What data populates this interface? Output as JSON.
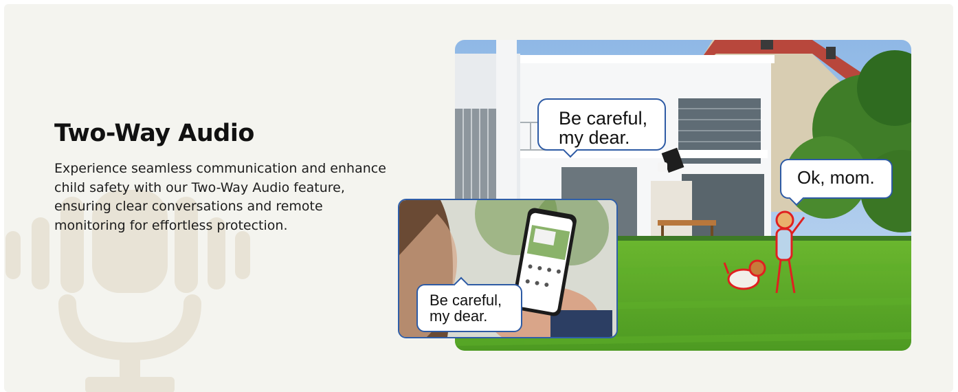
{
  "feature": {
    "title": "Two-Way Audio",
    "description": "Experience seamless communication and enhance child safety with our Two-Way Audio feature, ensuring clear conversations and remote monitoring for effortless protection."
  },
  "scene": {
    "bubble_parent": "Be careful,\nmy dear.",
    "bubble_child": "Ok, mom.",
    "bubble_phone": "Be careful,\nmy dear."
  },
  "icons": {
    "watermark": "microphone-icon"
  },
  "colors": {
    "background": "#f4f4ef",
    "bubble_border": "#2d5aa4",
    "highlight_outline": "#e02020",
    "lawn": "#5aa42a"
  }
}
